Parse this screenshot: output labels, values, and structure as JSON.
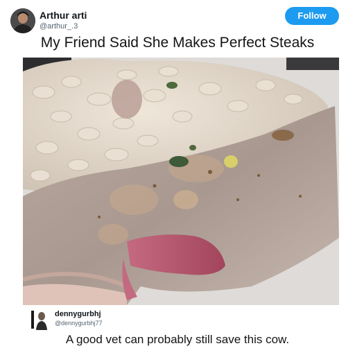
{
  "post": {
    "author_name": "Arthur arti",
    "author_handle": "@arthur_.3",
    "follow_label": "Follow",
    "title": "My Friend Said She Makes Perfect Steaks"
  },
  "reply": {
    "author_name": "dennygurbhj",
    "author_handle": "@dennygurbhj77",
    "text": "A good vet can probably still save this cow."
  },
  "colors": {
    "follow_button": "#1d9bf0",
    "handle_text": "#536471"
  }
}
